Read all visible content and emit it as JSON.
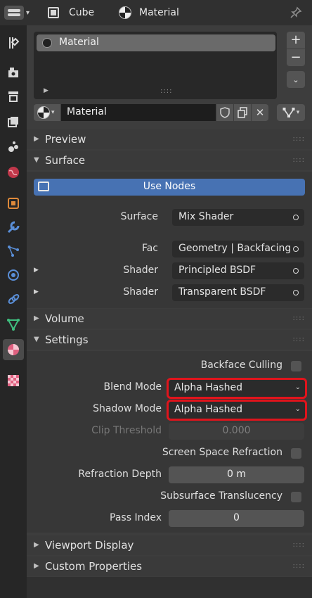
{
  "header": {
    "object_name": "Cube",
    "tab_name": "Material"
  },
  "sidebar": {
    "tabs": [
      {
        "icon": "tool-icon"
      },
      {
        "icon": "render-icon"
      },
      {
        "icon": "output-icon"
      },
      {
        "icon": "view-layer-icon"
      },
      {
        "icon": "scene-icon"
      },
      {
        "icon": "world-icon"
      },
      {
        "icon": "object-icon"
      },
      {
        "icon": "modifier-icon"
      },
      {
        "icon": "particles-icon"
      },
      {
        "icon": "physics-icon"
      },
      {
        "icon": "object-data-icon"
      },
      {
        "icon": "material-icon",
        "active": true
      },
      {
        "icon": "texture-icon"
      }
    ]
  },
  "slots": {
    "items": [
      "Material"
    ],
    "add_label": "+",
    "remove_label": "−"
  },
  "datablock": {
    "name": "Material"
  },
  "panels": {
    "preview": "Preview",
    "surface": "Surface",
    "volume": "Volume",
    "settings": "Settings",
    "viewport_display": "Viewport Display",
    "custom_properties": "Custom Properties"
  },
  "surface": {
    "use_nodes_label": "Use Nodes",
    "surface_label": "Surface",
    "surface_value": "Mix Shader",
    "fac_label": "Fac",
    "fac_value": "Geometry | Backfacing",
    "shader1_label": "Shader",
    "shader1_value": "Principled BSDF",
    "shader2_label": "Shader",
    "shader2_value": "Transparent BSDF"
  },
  "settings": {
    "backface_culling_label": "Backface Culling",
    "backface_culling": false,
    "blend_mode_label": "Blend Mode",
    "blend_mode_value": "Alpha Hashed",
    "shadow_mode_label": "Shadow Mode",
    "shadow_mode_value": "Alpha Hashed",
    "clip_threshold_label": "Clip Threshold",
    "clip_threshold_value": "0.000",
    "ssr_label": "Screen Space Refraction",
    "ssr": false,
    "refraction_depth_label": "Refraction Depth",
    "refraction_depth_value": "0 m",
    "subsurface_label": "Subsurface Translucency",
    "subsurface": false,
    "pass_index_label": "Pass Index",
    "pass_index_value": "0"
  },
  "colors": {
    "accent": "#4772b3",
    "highlight_outline": "#e0141c"
  }
}
